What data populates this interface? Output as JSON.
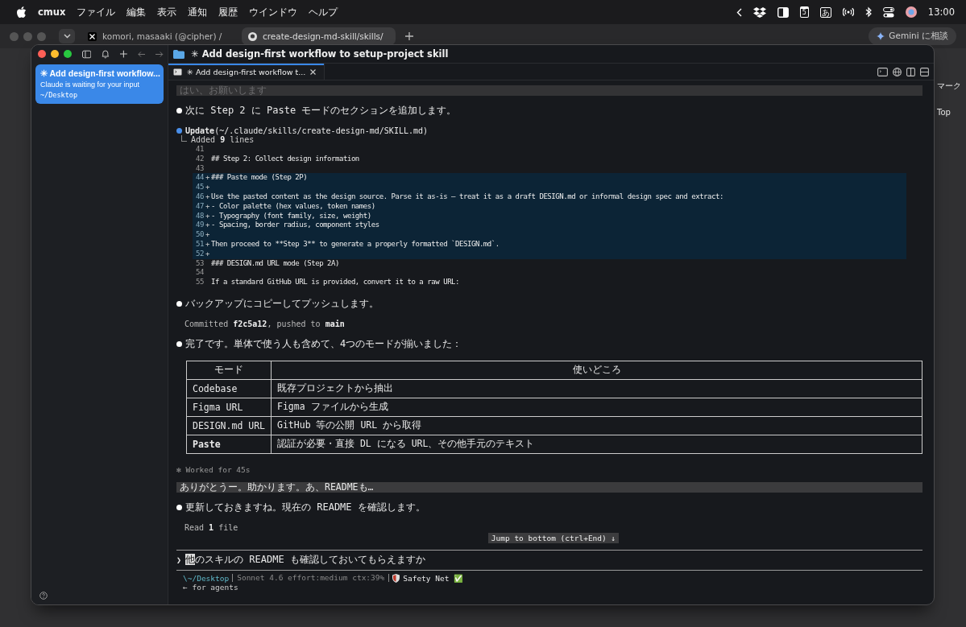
{
  "menubar": {
    "app": "cmux",
    "menus": [
      "ファイル",
      "編集",
      "表示",
      "通知",
      "履歴",
      "ウインドウ",
      "ヘルプ"
    ],
    "calendar_day": "5",
    "input_mode": "あ",
    "time": "13:00"
  },
  "browser": {
    "tabs": [
      {
        "label": "komori, masaaki (@cipher) / ",
        "selected": false
      },
      {
        "label": "create-design-md-skill/skills/",
        "selected": true
      }
    ],
    "assistant_button": "Gemini に相談",
    "side_texts": [
      "マーク",
      "Top"
    ]
  },
  "window": {
    "title": "✳ Add design-first workflow to setup-project skill",
    "workspaces": [
      {
        "title": "✳ Add design-first workflow...",
        "subtitle": "Claude is waiting for your input",
        "path": "~/Desktop",
        "selected": true
      }
    ],
    "tabs": [
      {
        "label": "✳ Add design-first workflow t...",
        "selected": true
      }
    ],
    "conversation": [
      {
        "kind": "user",
        "text": "はい、お願いします",
        "dimmed": true
      },
      {
        "kind": "message",
        "text": "次に Step 2 に Paste モードのセクションを追加します。"
      },
      {
        "kind": "tool",
        "name": "Update",
        "argument": "(~/.claude/skills/create-design-md/SKILL.md)",
        "result": "Added **9** lines",
        "diff": [
          {
            "num": "41",
            "added": false
          },
          {
            "num": "42",
            "text": "## Step 2: Collect design information",
            "added": false
          },
          {
            "num": "43",
            "added": false
          },
          {
            "num": "44",
            "sign": "+",
            "text": "### Paste mode (Step 2P)",
            "added": true
          },
          {
            "num": "45",
            "sign": "+",
            "added": true
          },
          {
            "num": "46",
            "sign": "+",
            "text": "Use the pasted content as the design source. Parse it as-is — treat it as a draft DESIGN.md or informal design spec and extract:",
            "added": true
          },
          {
            "num": "47",
            "sign": "+",
            "text": "- Color palette (hex values, token names)",
            "added": true
          },
          {
            "num": "48",
            "sign": "+",
            "text": "- Typography (font family, size, weight)",
            "added": true
          },
          {
            "num": "49",
            "sign": "+",
            "text": "- Spacing, border radius, component styles",
            "added": true
          },
          {
            "num": "50",
            "sign": "+",
            "added": true
          },
          {
            "num": "51",
            "sign": "+",
            "text": "Then proceed to **Step 3** to generate a properly formatted `DESIGN.md`.",
            "added": true
          },
          {
            "num": "52",
            "sign": "+",
            "added": true
          },
          {
            "num": "53",
            "text": "### DESIGN.md URL mode (Step 2A)",
            "added": false
          },
          {
            "num": "54",
            "added": false
          },
          {
            "num": "55",
            "text": "If a standard GitHub URL is provided, convert it to a raw URL:",
            "added": false
          }
        ]
      },
      {
        "kind": "message",
        "text": "バックアップにコピーしてプッシュします。"
      },
      {
        "kind": "result",
        "text": "Committed **f2c5a12**, pushed to **main**"
      },
      {
        "kind": "message",
        "text": "完了です。単体で使う人も含めて、4つのモードが揃いました："
      },
      {
        "kind": "table",
        "columns": [
          "モード",
          "使いどころ"
        ],
        "rows": [
          {
            "cells": [
              "Codebase",
              "既存プロジェクトから抽出"
            ],
            "bold": false
          },
          {
            "cells": [
              "Figma URL",
              "Figma ファイルから生成"
            ],
            "bold": false
          },
          {
            "cells": [
              "DESIGN.md URL",
              "GitHub 等の公開 URL から取得"
            ],
            "bold": false
          },
          {
            "cells": [
              "Paste",
              "認証が必要・直接 DL になる URL、その他手元のテキスト"
            ],
            "bold": true
          }
        ]
      },
      {
        "kind": "status",
        "symbol": "✻",
        "text": "Worked for 45s"
      },
      {
        "kind": "user",
        "text": "ありがとうー。助かります。あ、READMEも…",
        "dimmed": false
      },
      {
        "kind": "message",
        "text": "更新しておきますね。現在の README を確認します。"
      },
      {
        "kind": "result",
        "text": "Read **1** file"
      }
    ],
    "jump_button": "Jump to bottom (ctrl+End) ↓",
    "prompt": {
      "symbol": "❯",
      "value": "他のスキルの README も確認しておいてもらえますか"
    },
    "statusline": {
      "path": "\\~/Desktop",
      "model": "Sonnet 4.6 effort:medium ctx:39%",
      "safety": "Safety Net ✅",
      "hint": "← for agents"
    }
  }
}
